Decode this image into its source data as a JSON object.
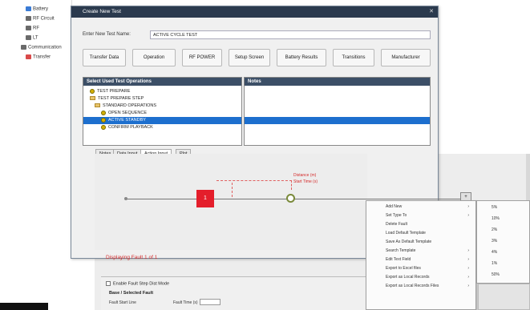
{
  "left_tree": {
    "items": [
      {
        "label": "Battery",
        "color": "#3a7bd5"
      },
      {
        "label": "RF Circuit",
        "color": "#6a6a6a"
      },
      {
        "label": "RF",
        "color": "#6a6a6a"
      },
      {
        "label": "LT",
        "color": "#6a6a6a"
      },
      {
        "label": "Communication",
        "color": "#6a6a6a"
      },
      {
        "label": "Transfer",
        "color": "#d94a4a"
      }
    ]
  },
  "dialog": {
    "title": "Create New Test",
    "name_label": "Enter New Test Name:",
    "name_value": "ACTIVE CYCLE TEST",
    "buttons": [
      "Transfer Data",
      "Operation",
      "RF POWER",
      "Setup Screen",
      "Battery Results",
      "Transitions",
      "Manufacturer"
    ],
    "left_panel_header": "Select Used Test Operations",
    "right_panel_header": "Notes",
    "tree_rows": [
      {
        "label": "TEST PREPARE",
        "kind": "dot",
        "indent": 1,
        "selected": false
      },
      {
        "label": "TEST PREPARE STEP",
        "kind": "folder",
        "indent": 1,
        "selected": false
      },
      {
        "label": "STANDARD OPERATIONS",
        "kind": "folder",
        "indent": 2,
        "selected": false
      },
      {
        "label": "OPEN SEQUENCE",
        "kind": "dot",
        "indent": 3,
        "selected": false
      },
      {
        "label": "ACTIVE STANDBY",
        "kind": "dot",
        "indent": 3,
        "selected": true
      },
      {
        "label": "CONFIRM PLAYBACK",
        "kind": "dot",
        "indent": 3,
        "selected": false
      }
    ],
    "tabs": [
      "Notes",
      "Data Input",
      "Action Input",
      "Plot"
    ],
    "active_tab": "Action Input"
  },
  "canvas": {
    "red_marker_label": "1",
    "red_label_line1": "Distance (m)",
    "red_label_line2": "Start Time (s)",
    "mini_button": "+",
    "displaying": "Displaying Fault 1 of 1"
  },
  "context_menu": {
    "items": [
      {
        "label": "Add New",
        "arrow": true
      },
      {
        "label": "Set Type To",
        "arrow": true
      },
      {
        "label": "Delete Fault",
        "arrow": false
      },
      {
        "label": "Load Default Template",
        "arrow": false
      },
      {
        "label": "Save As Default Template",
        "arrow": false
      },
      {
        "label": "Search Template",
        "arrow": true
      },
      {
        "label": "Edit Text Field",
        "arrow": true
      },
      {
        "label": "Export to Excel files",
        "arrow": true
      },
      {
        "label": "Export as Local Records",
        "arrow": true
      },
      {
        "label": "Export as Local Records Files",
        "arrow": true
      }
    ]
  },
  "sub_menu": {
    "items": [
      "5%",
      "10%",
      "2%",
      "3%",
      "4%",
      "1%",
      "50%"
    ]
  },
  "bottom_panel": {
    "checkbox_label": "Enable Fault Step Dist Mode",
    "section": "Base / Selected Fault",
    "field1_label": "Fault Start Line",
    "field2_label": "Fault Time (s)"
  }
}
